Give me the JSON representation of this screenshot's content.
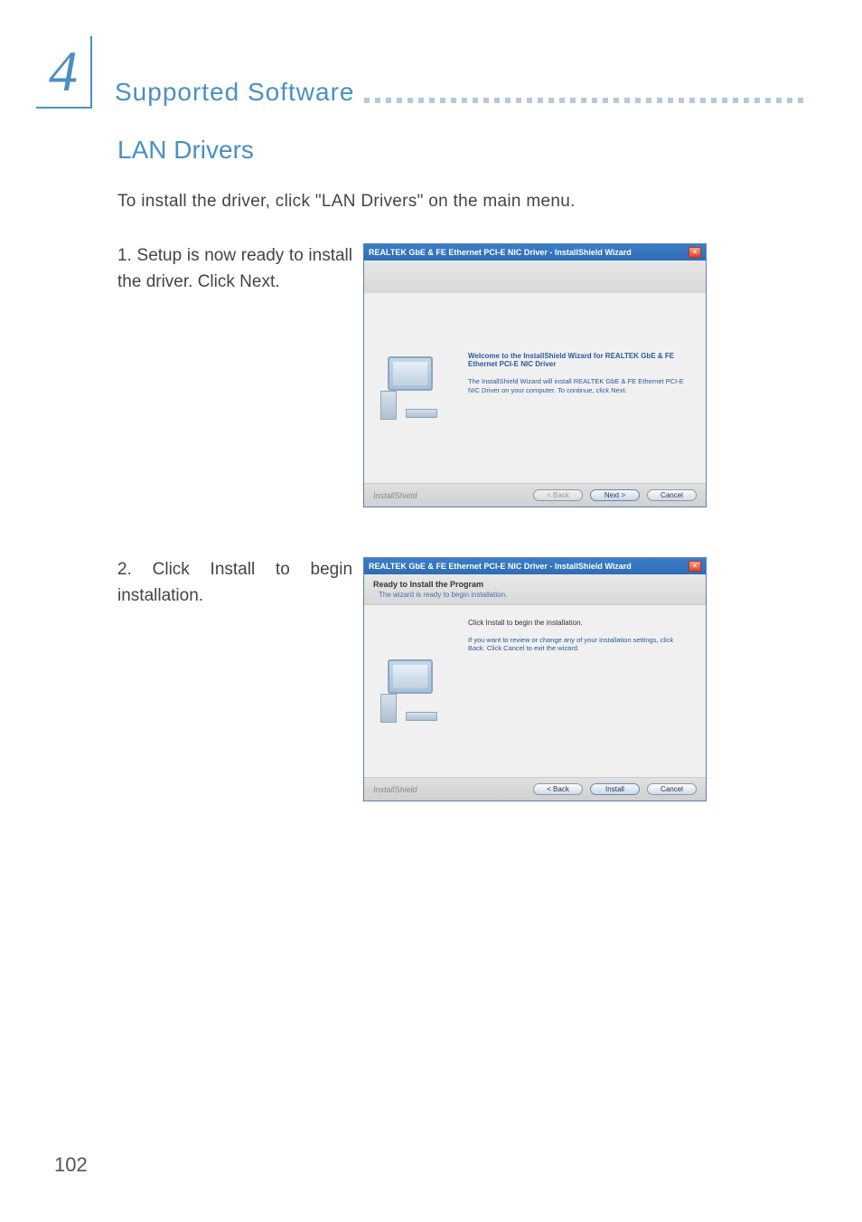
{
  "chapter": {
    "number": "4",
    "title": "Supported Software"
  },
  "section": {
    "title": "LAN Drivers",
    "intro": "To install the driver, click \"LAN Drivers\" on the main menu."
  },
  "steps": [
    {
      "num": "1.",
      "text": "Setup is now ready to install the driver. Click Next."
    },
    {
      "num": "2.",
      "text": "Click Install to begin installation."
    }
  ],
  "dialog1": {
    "title": "REALTEK GbE & FE Ethernet PCI-E NIC Driver - InstallShield Wizard",
    "welcome_title": "Welcome to the InstallShield Wizard for REALTEK GbE & FE Ethernet PCI-E NIC Driver",
    "welcome_body": "The InstallShield Wizard will install REALTEK GbE & FE Ethernet PCI-E NIC Driver on your computer.  To continue, click Next.",
    "footer_brand": "InstallShield",
    "btn_back": "< Back",
    "btn_next": "Next >",
    "btn_cancel": "Cancel"
  },
  "dialog2": {
    "title": "REALTEK GbE & FE Ethernet PCI-E NIC Driver - InstallShield Wizard",
    "sub_title": "Ready to Install the Program",
    "sub_desc": "The wizard is ready to begin installation.",
    "body_line1": "Click Install to begin the installation.",
    "body_line2": "If you want to review or change any of your installation settings, click Back. Click Cancel to exit the wizard.",
    "footer_brand": "InstallShield",
    "btn_back": "< Back",
    "btn_install": "Install",
    "btn_cancel": "Cancel"
  },
  "page_number": "102"
}
